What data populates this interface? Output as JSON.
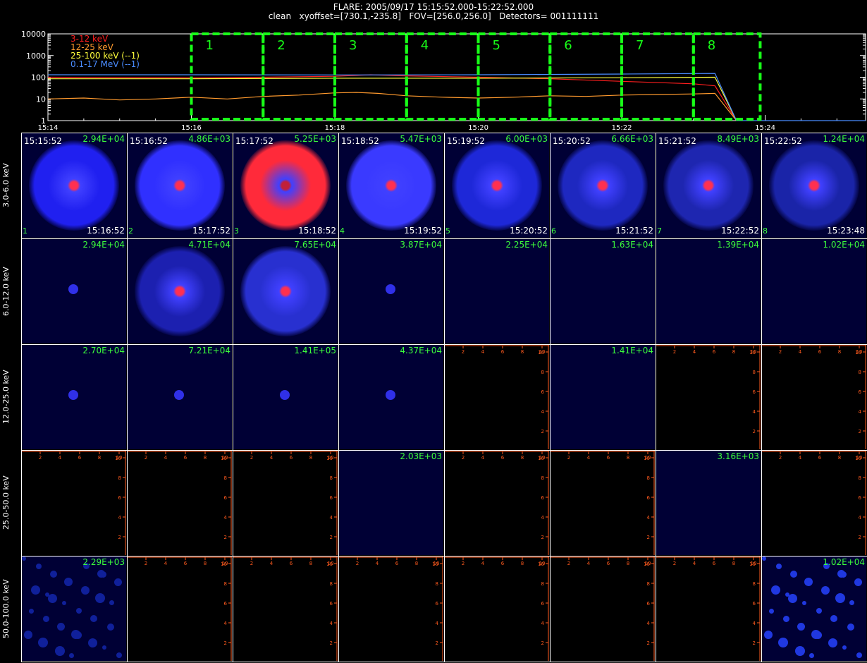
{
  "header": {
    "line1": "FLARE: 2005/09/17 15:15:52.000-15:22:52.000",
    "line2": "clean   xyoffset=[730.1,-235.8]   FOV=[256.0,256.0]   Detectors= 001111111"
  },
  "chart_data": {
    "type": "line",
    "yscale": "log",
    "ylim": [
      1,
      10000
    ],
    "y_ticks": [
      "1",
      "10",
      "100",
      "1000",
      "10000"
    ],
    "x_ticks": [
      "15:14",
      "15:16",
      "15:18",
      "15:20",
      "15:22",
      "15:24"
    ],
    "x_tick_minutes": [
      0,
      2,
      4,
      6,
      8,
      10
    ],
    "x_range_minutes": [
      0,
      11.4
    ],
    "series": [
      {
        "name": "3-12 keV",
        "color": "#ff1e1e",
        "x": [
          0,
          2,
          3,
          4,
          4.5,
          5,
          6,
          7,
          8,
          9,
          9.3,
          9.6
        ],
        "y": [
          100,
          95,
          100,
          110,
          130,
          115,
          100,
          85,
          65,
          50,
          40,
          1
        ]
      },
      {
        "name": "12-25 keV",
        "color": "#ff9a2e",
        "x": [
          0,
          0.5,
          1,
          1.5,
          2,
          2.5,
          3,
          3.5,
          4,
          4.3,
          4.6,
          5,
          5.5,
          6,
          6.5,
          7,
          7.5,
          8,
          8.5,
          9,
          9.3,
          9.6
        ],
        "y": [
          10,
          11,
          9,
          10,
          12,
          10,
          13,
          15,
          19,
          20,
          18,
          14,
          12,
          11,
          12,
          14,
          13,
          15,
          16,
          17,
          18,
          1
        ]
      },
      {
        "name": "25-100 keV (--1)",
        "color": "#ffff3c",
        "x": [
          0,
          2,
          4,
          6,
          8,
          9.3,
          9.6
        ],
        "y": [
          85,
          85,
          90,
          90,
          95,
          100,
          1
        ]
      },
      {
        "name": "0.1-17 MeV (--1)",
        "color": "#4a8cff",
        "x": [
          0,
          2,
          4,
          6,
          8,
          9.3,
          9.6,
          11.4
        ],
        "y": [
          130,
          130,
          128,
          130,
          140,
          150,
          1,
          1
        ]
      }
    ],
    "intervals": [
      {
        "label": "1",
        "start": 2,
        "end": 3
      },
      {
        "label": "2",
        "start": 3,
        "end": 4
      },
      {
        "label": "3",
        "start": 4,
        "end": 5
      },
      {
        "label": "4",
        "start": 5,
        "end": 6
      },
      {
        "label": "5",
        "start": 6,
        "end": 7
      },
      {
        "label": "6",
        "start": 7,
        "end": 8
      },
      {
        "label": "7",
        "start": 8,
        "end": 9
      },
      {
        "label": "8",
        "start": 9,
        "end": 9.93
      }
    ],
    "interval_color": "#18ff18",
    "legend_placement": "top-left"
  },
  "image_grid": {
    "columns": [
      {
        "start": "15:15:52",
        "end": "15:16:52",
        "index": "1"
      },
      {
        "start": "15:16:52",
        "end": "15:17:52",
        "index": "2"
      },
      {
        "start": "15:17:52",
        "end": "15:18:52",
        "index": "3"
      },
      {
        "start": "15:18:52",
        "end": "15:19:52",
        "index": "4"
      },
      {
        "start": "15:19:52",
        "end": "15:20:52",
        "index": "5"
      },
      {
        "start": "15:20:52",
        "end": "15:21:52",
        "index": "6"
      },
      {
        "start": "15:21:52",
        "end": "15:22:52",
        "index": "7"
      },
      {
        "start": "15:22:52",
        "end": "15:23:48",
        "index": "8"
      }
    ],
    "rows": [
      {
        "label": "3.0-6.0 keV",
        "cells": [
          "2.94E+04",
          "4.86E+03",
          "5.25E+03",
          "5.47E+03",
          "6.00E+03",
          "6.66E+03",
          "8.49E+03",
          "1.24E+04"
        ]
      },
      {
        "label": "6.0-12.0 keV",
        "cells": [
          "2.94E+04",
          "4.71E+04",
          "7.65E+04",
          "3.87E+04",
          "2.25E+04",
          "1.63E+04",
          "1.39E+04",
          "1.02E+04"
        ]
      },
      {
        "label": "12.0-25.0 keV",
        "cells": [
          "2.70E+04",
          "7.21E+04",
          "1.41E+05",
          "4.37E+04",
          "",
          "1.41E+04",
          "",
          ""
        ]
      },
      {
        "label": "25.0-50.0 keV",
        "cells": [
          "",
          "",
          "",
          "2.03E+03",
          "",
          "",
          "3.16E+03",
          ""
        ]
      },
      {
        "label": "50.0-100.0 keV",
        "cells": [
          "2.29E+03",
          "",
          "",
          "",
          "",
          "",
          "",
          "1.02E+04"
        ]
      }
    ],
    "empty_axis_ticks": [
      "2",
      "4",
      "6",
      "8",
      "10"
    ],
    "empty_axis_color": "#ff5a1e"
  }
}
